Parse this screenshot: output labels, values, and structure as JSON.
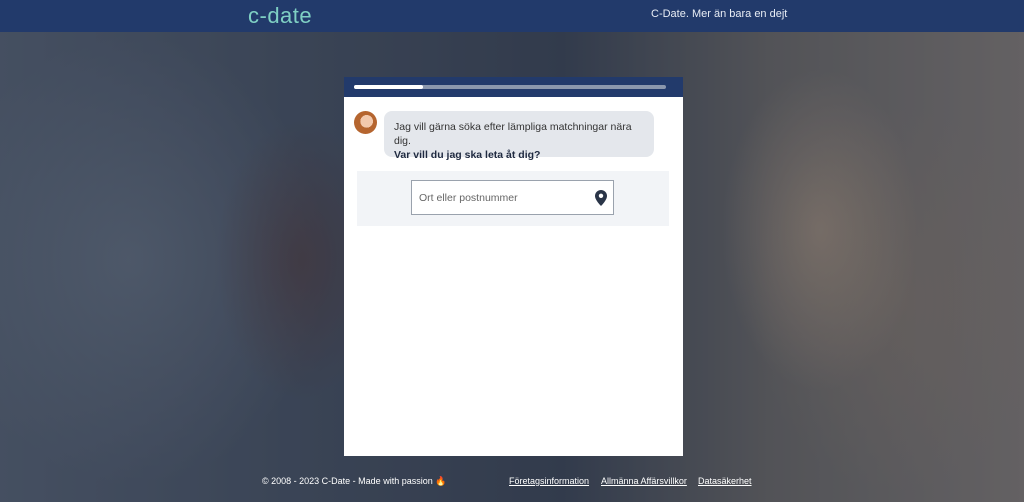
{
  "header": {
    "logo": "c-date",
    "tagline": "C-Date. Mer än bara en dejt"
  },
  "progress": {
    "fraction": 0.22
  },
  "chat": {
    "message_line1": "Jag vill gärna söka efter lämpliga matchningar nära dig.",
    "message_question": "Var vill du jag ska leta åt dig?"
  },
  "location": {
    "placeholder": "Ort eller postnummer",
    "icon": "map-pin-icon"
  },
  "footer": {
    "copyright": "© 2008 - 2023 C-Date - Made with passion",
    "flame_icon": "🔥",
    "links": [
      "Företagsinformation",
      "Allmänna Affärsvillkor",
      "Datasäkerhet"
    ]
  },
  "colors": {
    "brand_navy": "#223a6b",
    "logo_teal": "#7fd0c4"
  }
}
